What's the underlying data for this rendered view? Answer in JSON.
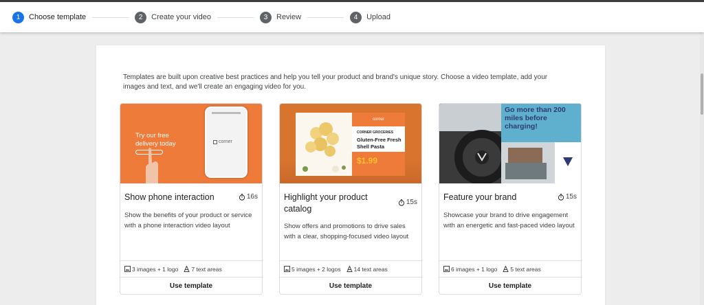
{
  "stepper": {
    "steps": [
      {
        "num": "1",
        "label": "Choose template"
      },
      {
        "num": "2",
        "label": "Create your video"
      },
      {
        "num": "3",
        "label": "Review"
      },
      {
        "num": "4",
        "label": "Upload"
      }
    ]
  },
  "intro": "Templates are built upon creative best practices and help you tell your product and brand's unique story. Choose a video template, add your images and text, and we'll create an engaging video for you.",
  "cards": [
    {
      "title": "Show phone interaction",
      "duration": "16s",
      "description": "Show the benefits of your product or service with a phone interaction video layout",
      "images": "3 images + 1 logo",
      "text_areas": "7 text areas",
      "button": "Use template",
      "thumb_text": "Try our free delivery today",
      "thumb_logo": "corner"
    },
    {
      "title": "Highlight your product catalog",
      "duration": "15s",
      "description": "Show offers and promotions to drive sales with a clear, shopping-focused video layout",
      "images": "5 images + 2 logos",
      "text_areas": "14 text areas",
      "button": "Use template",
      "thumb_logo": "corner",
      "thumb_store": "CORNER GROCERIES",
      "thumb_product": "Gluten-Free Fresh Shell Pasta",
      "thumb_price": "$1.99"
    },
    {
      "title": "Feature your brand",
      "duration": "15s",
      "description": "Showcase your brand to drive engagement with an energetic and fast-paced video layout",
      "images": "6 images + 1 logo",
      "text_areas": "5 text areas",
      "button": "Use template",
      "thumb_text": "Go more than 200 miles before charging!"
    }
  ],
  "colors": {
    "accent": "#1a73e8",
    "orange": "#ef7b3a",
    "teal": "#5fb0cf",
    "price": "#ffbf2e"
  }
}
